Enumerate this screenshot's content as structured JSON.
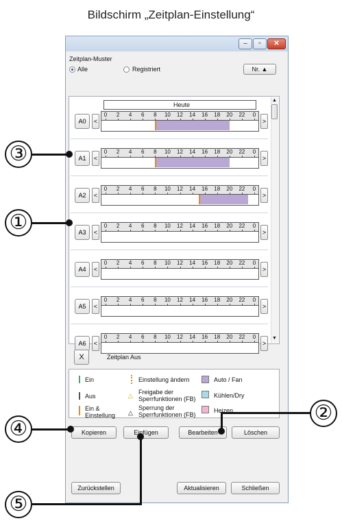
{
  "page_title": "Bildschirm „Zeitplan-Einstellung“",
  "window": {
    "section_label": "Zeitplan-Muster",
    "radio_all": "Alle",
    "radio_registered": "Registriert",
    "sort_button": "Nr. ▲",
    "today_label": "Heute",
    "hours": [
      "0",
      "2",
      "4",
      "6",
      "8",
      "10",
      "12",
      "14",
      "16",
      "18",
      "20",
      "22",
      "0"
    ],
    "rows": [
      {
        "id": "A0",
        "bar": [
          8,
          20
        ]
      },
      {
        "id": "A1",
        "bar": [
          8,
          20
        ]
      },
      {
        "id": "A2",
        "bar": [
          15,
          23
        ]
      },
      {
        "id": "A3",
        "bar": null
      },
      {
        "id": "A4",
        "bar": null
      },
      {
        "id": "A5",
        "bar": null
      },
      {
        "id": "A6",
        "bar": null
      }
    ],
    "arrow_left": "<",
    "arrow_right": ">",
    "off_button": "X",
    "off_label": "Zeitplan Aus",
    "legend": {
      "on": "Ein",
      "off": "Aus",
      "on_setting": "Ein & Einstellung",
      "change_setting": "Einstellung ändern",
      "release_lock": "Freigabe der Sperrfunktionen (FB)",
      "lock": "Sperrung der Sperrfunktionen (FB)",
      "auto_fan": "Auto / Fan",
      "cool_dry": "Kühlen/Dry",
      "heat": "Heizen"
    },
    "colors": {
      "on": "#2fb36a",
      "off": "#555555",
      "on_setting": "#f08a00",
      "auto_fan": "#b9a7d4",
      "cool_dry": "#a9dbe6",
      "heat": "#f2b5d4"
    },
    "buttons": {
      "copy": "Kopieren",
      "paste": "Einfügen",
      "edit": "Bearbeiten",
      "delete": "Löschen"
    },
    "footer": {
      "reset": "Zurückstellen",
      "refresh": "Aktualisieren",
      "close": "Schließen"
    }
  },
  "callouts": [
    "③",
    "①",
    "②",
    "④",
    "⑤"
  ]
}
